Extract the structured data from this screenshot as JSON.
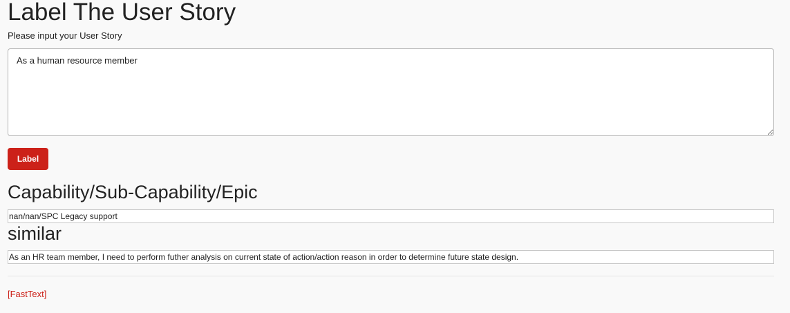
{
  "page": {
    "title": "Label The User Story",
    "prompt_label": "Please input your User Story"
  },
  "story_input": {
    "value": "As a human resource member"
  },
  "label_button": {
    "label": "Label"
  },
  "capability_section": {
    "heading": "Capability/Sub-Capability/Epic",
    "result": "nan/nan/SPC Legacy support"
  },
  "similar_section": {
    "heading": "similar",
    "result": "As an HR team member, I need to perform futher analysis on current state of action/action reason in order to determine future state design."
  },
  "footer": {
    "link_text": "[FastText]"
  },
  "colors": {
    "accent": "#cc2119",
    "background": "#f9f9f9"
  }
}
